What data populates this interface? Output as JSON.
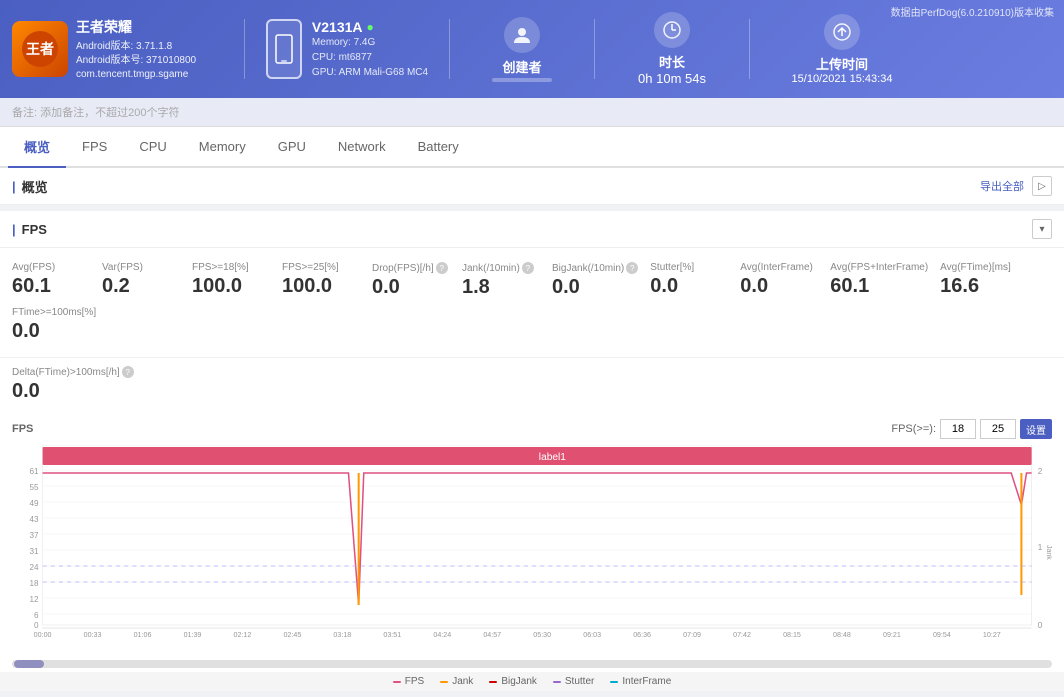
{
  "top_note": "数据由PerfDog(6.0.210910)版本收集",
  "header": {
    "app": {
      "icon_text": "王者",
      "name": "王者荣耀",
      "android_version": "Android版本: 3.71.1.8",
      "android_sdk": "Android版本号: 371010800",
      "package": "com.tencent.tmgp.sgame"
    },
    "device": {
      "name": "V2131A",
      "signal": "●",
      "memory": "Memory: 7.4G",
      "cpu": "CPU: mt6877",
      "gpu": "GPU: ARM Mali-G68 MC4"
    },
    "creator": {
      "label": "创建者",
      "value": ""
    },
    "duration": {
      "label": "时长",
      "value": "0h 10m 54s"
    },
    "upload": {
      "label": "上传时间",
      "value": "15/10/2021 15:43:34"
    }
  },
  "notes": {
    "placeholder": "备注: 添加备注，不超过200个字符"
  },
  "tabs": [
    {
      "id": "overview",
      "label": "概览",
      "active": true
    },
    {
      "id": "fps",
      "label": "FPS",
      "active": false
    },
    {
      "id": "cpu",
      "label": "CPU",
      "active": false
    },
    {
      "id": "memory",
      "label": "Memory",
      "active": false
    },
    {
      "id": "gpu",
      "label": "GPU",
      "active": false
    },
    {
      "id": "network",
      "label": "Network",
      "active": false
    },
    {
      "id": "battery",
      "label": "Battery",
      "active": false
    }
  ],
  "overview": {
    "title": "概览",
    "export_label": "导出全部"
  },
  "fps_section": {
    "title": "FPS",
    "metrics": [
      {
        "id": "avg_fps",
        "label": "Avg(FPS)",
        "value": "60.1",
        "has_help": false
      },
      {
        "id": "var_fps",
        "label": "Var(FPS)",
        "value": "0.2",
        "has_help": false
      },
      {
        "id": "fps_gte18",
        "label": "FPS>=18[%]",
        "value": "100.0",
        "has_help": false
      },
      {
        "id": "fps_gte25",
        "label": "FPS>=25[%]",
        "value": "100.0",
        "has_help": false
      },
      {
        "id": "drop_fps",
        "label": "Drop(FPS)[/h]",
        "value": "0.0",
        "has_help": true
      },
      {
        "id": "jank",
        "label": "Jank(/10min)",
        "value": "1.8",
        "has_help": true
      },
      {
        "id": "big_jank",
        "label": "BigJank(/10min)",
        "value": "0.0",
        "has_help": true
      },
      {
        "id": "stutter",
        "label": "Stutter[%]",
        "value": "0.0",
        "has_help": false
      },
      {
        "id": "avg_interframe",
        "label": "Avg(InterFrame)",
        "value": "0.0",
        "has_help": false
      },
      {
        "id": "avg_fps_interframe",
        "label": "Avg(FPS+InterFrame)",
        "value": "60.1",
        "has_help": false
      },
      {
        "id": "avg_ftime",
        "label": "Avg(FTime)[ms]",
        "value": "16.6",
        "has_help": false
      },
      {
        "id": "ftime_gte100",
        "label": "FTime>=100ms[%]",
        "value": "0.0",
        "has_help": false
      }
    ],
    "delta": {
      "label": "Delta(FTime)>100ms[/h]",
      "value": "0.0",
      "has_help": true
    },
    "chart": {
      "y_label": "FPS",
      "fps_gte_label": "FPS(>=):",
      "fps_val1": "18",
      "fps_val2": "25",
      "set_label": "设置",
      "label1": "label1",
      "x_ticks": [
        "00:00",
        "00:33",
        "01:06",
        "01:39",
        "02:12",
        "02:45",
        "03:18",
        "03:51",
        "04:24",
        "04:57",
        "05:30",
        "06:03",
        "06:36",
        "07:09",
        "07:42",
        "08:15",
        "08:48",
        "09:21",
        "09:54",
        "10:27"
      ],
      "y_ticks": [
        "61",
        "55",
        "49",
        "43",
        "37",
        "31",
        "24",
        "18",
        "12",
        "6",
        "0"
      ],
      "right_y_ticks": [
        "2",
        "1",
        "0"
      ],
      "jank_label": "Jank"
    }
  },
  "legend": [
    {
      "label": "FPS",
      "color": "#e05080"
    },
    {
      "label": "Jank",
      "color": "#ff9900"
    },
    {
      "label": "BigJank",
      "color": "#cc0000"
    },
    {
      "label": "Stutter",
      "color": "#9966cc"
    },
    {
      "label": "InterFrame",
      "color": "#00aacc"
    }
  ]
}
